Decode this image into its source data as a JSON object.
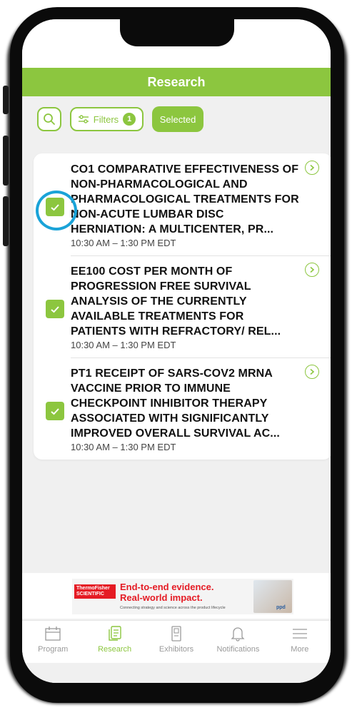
{
  "header": {
    "title": "Research"
  },
  "toolbar": {
    "search_icon": "search-icon",
    "filters_label": "Filters",
    "filters_count": "1",
    "selected_label": "Selected"
  },
  "items": [
    {
      "title": "CO1 COMPARATIVE EFFECTIVENESS OF NON-PHARMACOLOGICAL AND PHARMACOLOGICAL TREATMENTS FOR NON-ACUTE LUMBAR DISC HERNIATION: A MULTICENTER, PR...",
      "time": "10:30 AM – 1:30 PM EDT",
      "checked": true
    },
    {
      "title": "EE100 COST PER MONTH OF PROGRESSION FREE SURVIVAL ANALYSIS OF THE CURRENTLY AVAILABLE TREATMENTS FOR PATIENTS WITH REFRACTORY/ REL...",
      "time": "10:30 AM – 1:30 PM EDT",
      "checked": true
    },
    {
      "title": "PT1 RECEIPT OF SARS-COV2 MRNA VACCINE PRIOR TO IMMUNE CHECKPOINT INHIBITOR THERAPY ASSOCIATED WITH SIGNIFICANTLY IMPROVED OVERALL SURVIVAL AC...",
      "time": "10:30 AM – 1:30 PM EDT",
      "checked": true
    }
  ],
  "ad": {
    "brand": "ThermoFisher SCIENTIFIC",
    "headline_1": "End-to-end evidence.",
    "headline_2": "Real-world impact.",
    "subline": "Connecting strategy and science across the product lifecycle",
    "partner": "ppd"
  },
  "tabs": [
    {
      "label": "Program",
      "icon": "calendar-icon",
      "active": false
    },
    {
      "label": "Research",
      "icon": "document-icon",
      "active": true
    },
    {
      "label": "Exhibitors",
      "icon": "booth-icon",
      "active": false
    },
    {
      "label": "Notifications",
      "icon": "bell-icon",
      "active": false
    },
    {
      "label": "More",
      "icon": "menu-icon",
      "active": false
    }
  ],
  "colors": {
    "accent": "#8cc63f",
    "highlight": "#1aa3d8"
  }
}
